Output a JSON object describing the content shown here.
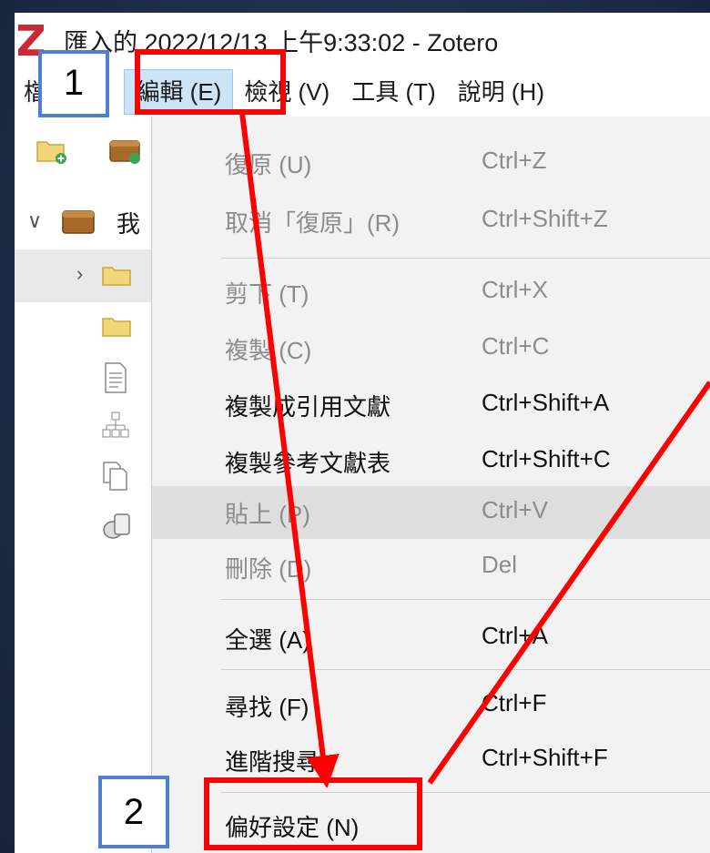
{
  "window": {
    "title": "匯入的 2022/12/13 上午9:33:02 - Zotero"
  },
  "menubar": {
    "file_label": "檔案 (F)",
    "edit_label": "編輯 (E)",
    "view_label": "檢視 (V)",
    "tools_label": "工具 (T)",
    "help_label": "說明 (H)"
  },
  "toolbar": {
    "icons": [
      "new-collection-icon",
      "new-library-icon"
    ]
  },
  "tree": {
    "library_label": "我",
    "icons": [
      "folder-icon",
      "folder-icon",
      "document-icon",
      "hierarchy-icon",
      "duplicates-icon",
      "trash-icon"
    ]
  },
  "edit_menu": {
    "items": [
      {
        "label": "復原 (U)",
        "shortcut": "Ctrl+Z",
        "enabled": false
      },
      {
        "label": "取消「復原」(R)",
        "shortcut": "Ctrl+Shift+Z",
        "enabled": false
      },
      {
        "label": "剪下 (T)",
        "shortcut": "Ctrl+X",
        "enabled": false
      },
      {
        "label": "複製 (C)",
        "shortcut": "Ctrl+C",
        "enabled": false
      },
      {
        "label": "複製成引用文獻",
        "shortcut": "Ctrl+Shift+A",
        "enabled": true
      },
      {
        "label": "複製參考文獻表",
        "shortcut": "Ctrl+Shift+C",
        "enabled": true
      },
      {
        "label": "貼上 (P)",
        "shortcut": "Ctrl+V",
        "enabled": false
      },
      {
        "label": "刪除 (D)",
        "shortcut": "Del",
        "enabled": false
      },
      {
        "label": "全選 (A)",
        "shortcut": "Ctrl+A",
        "enabled": true
      },
      {
        "label": "尋找 (F)",
        "shortcut": "Ctrl+F",
        "enabled": true
      },
      {
        "label": "進階搜尋",
        "shortcut": "Ctrl+Shift+F",
        "enabled": true
      },
      {
        "label": "偏好設定 (N)",
        "shortcut": "",
        "enabled": true
      }
    ]
  },
  "annotations": {
    "step1_label": "1",
    "step2_label": "2",
    "highlight_color": "#ff0000",
    "callout_border_color": "#4f7fcf"
  }
}
